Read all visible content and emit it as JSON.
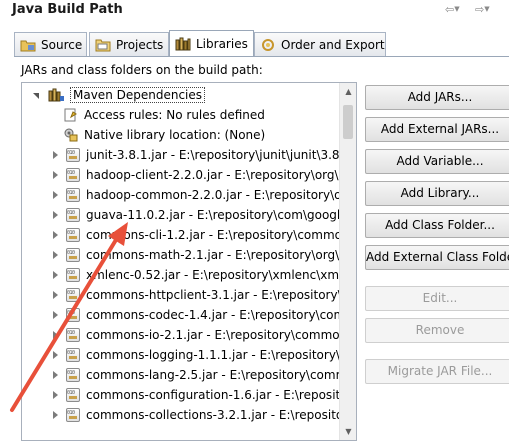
{
  "window": {
    "title": "Java Build Path"
  },
  "tabs": [
    {
      "label": "Source",
      "icon": "source-folder-icon",
      "active": false
    },
    {
      "label": "Projects",
      "icon": "projects-icon",
      "active": false
    },
    {
      "label": "Libraries",
      "icon": "libraries-icon",
      "active": true
    },
    {
      "label": "Order and Export",
      "icon": "order-export-icon",
      "active": false
    }
  ],
  "heading": "JARs and class folders on the build path:",
  "tree": {
    "root": "Maven Dependencies",
    "items": [
      {
        "label": "Access rules: No rules defined",
        "icon": "access-rules-icon"
      },
      {
        "label": "Native library location: (None)",
        "icon": "native-library-icon"
      },
      {
        "label": "junit-3.8.1.jar - E:\\repository\\junit\\junit\\3.8.1",
        "icon": "jar-icon"
      },
      {
        "label": "hadoop-client-2.2.0.jar - E:\\repository\\org\\a",
        "icon": "jar-icon"
      },
      {
        "label": "hadoop-common-2.2.0.jar - E:\\repository\\or",
        "icon": "jar-icon"
      },
      {
        "label": "guava-11.0.2.jar - E:\\repository\\com\\google",
        "icon": "jar-icon"
      },
      {
        "label": "commons-cli-1.2.jar - E:\\repository\\commor",
        "icon": "jar-icon"
      },
      {
        "label": "commons-math-2.1.jar - E:\\repository\\org\\a",
        "icon": "jar-icon"
      },
      {
        "label": "xmlenc-0.52.jar - E:\\repository\\xmlenc\\xmler",
        "icon": "jar-icon"
      },
      {
        "label": "commons-httpclient-3.1.jar - E:\\repository\\c",
        "icon": "jar-icon"
      },
      {
        "label": "commons-codec-1.4.jar - E:\\repository\\comm",
        "icon": "jar-icon"
      },
      {
        "label": "commons-io-2.1.jar - E:\\repository\\commons",
        "icon": "jar-icon"
      },
      {
        "label": "commons-logging-1.1.1.jar - E:\\repository\\c",
        "icon": "jar-icon"
      },
      {
        "label": "commons-lang-2.5.jar - E:\\repository\\common",
        "icon": "jar-icon"
      },
      {
        "label": "commons-configuration-1.6.jar - E:\\reposito",
        "icon": "jar-icon"
      },
      {
        "label": "commons-collections-3.2.1.jar - E:\\repositor",
        "icon": "jar-icon"
      }
    ]
  },
  "buttons": [
    {
      "label": "Add JARs...",
      "enabled": true
    },
    {
      "label": "Add External JARs...",
      "enabled": true
    },
    {
      "label": "Add Variable...",
      "enabled": true
    },
    {
      "label": "Add Library...",
      "enabled": true
    },
    {
      "label": "Add Class Folder...",
      "enabled": true
    },
    {
      "label": "Add External Class Folde",
      "enabled": true
    },
    {
      "label": "Edit...",
      "enabled": false
    },
    {
      "label": "Remove",
      "enabled": false
    },
    {
      "label": "Migrate JAR File...",
      "enabled": false
    }
  ],
  "colors": {
    "annotation_arrow": "#e8503a",
    "jar_band": "#c9a14a"
  }
}
